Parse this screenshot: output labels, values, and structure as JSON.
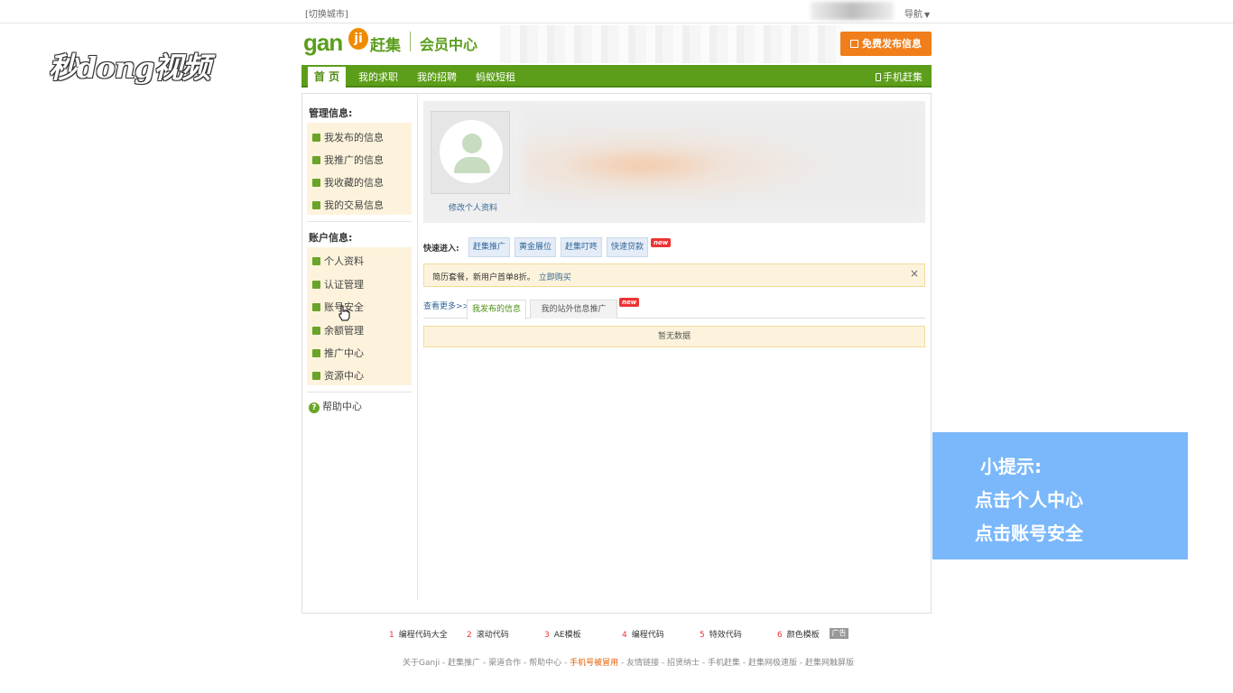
{
  "topbar": {
    "city_switch": "[切换城市]",
    "nav_menu": "导航"
  },
  "watermark": {
    "logo_text": "秒dong视频"
  },
  "header": {
    "logo_latin": "gan",
    "logo_badge": "ji",
    "logo_cn": "赶集",
    "member_center": "会员中心",
    "post_button": "免费发布信息"
  },
  "nav": {
    "tabs": [
      {
        "label": "首 页"
      },
      {
        "label": "我的求职"
      },
      {
        "label": "我的招聘"
      },
      {
        "label": "蚂蚁短租"
      }
    ],
    "mobile": "手机赶集"
  },
  "sidebar": {
    "manage_title": "管理信息:",
    "manage_items": [
      {
        "label": "我发布的信息"
      },
      {
        "label": "我推广的信息"
      },
      {
        "label": "我收藏的信息"
      },
      {
        "label": "我的交易信息"
      }
    ],
    "account_title": "账户信息:",
    "account_items": [
      {
        "label": "个人资料"
      },
      {
        "label": "认证管理"
      },
      {
        "label": "账号安全"
      },
      {
        "label": "余额管理"
      },
      {
        "label": "推广中心"
      },
      {
        "label": "资源中心"
      }
    ],
    "help": "帮助中心"
  },
  "profile": {
    "edit_link": "修改个人资料"
  },
  "quick_entry": {
    "label": "快速进入:",
    "buttons": [
      {
        "label": "赶集推广"
      },
      {
        "label": "黄金展位"
      },
      {
        "label": "赶集叮咚"
      },
      {
        "label": "快速贷款"
      }
    ],
    "new_badge": "new"
  },
  "notice": {
    "text": "简历套餐，新用户首单8折。",
    "link": "立即购买",
    "close": "×"
  },
  "posts": {
    "more": "查看更多>>",
    "tabs": [
      {
        "label": "我发布的信息"
      },
      {
        "label": "我的站外信息推广"
      }
    ],
    "new_badge": "new",
    "empty": "暂无数据"
  },
  "tip": {
    "title": "小提示:",
    "line1": "点击个人中心",
    "line2": "点击账号安全"
  },
  "footer": {
    "links": [
      {
        "num": "1",
        "label": "编程代码大全"
      },
      {
        "num": "2",
        "label": "滚动代码"
      },
      {
        "num": "3",
        "label": "AE模板"
      },
      {
        "num": "4",
        "label": "编程代码"
      },
      {
        "num": "5",
        "label": "特效代码"
      },
      {
        "num": "6",
        "label": "颜色模板"
      }
    ],
    "ad": "广告",
    "bottom_pre": "关于Ganji - 赶集推广 - 渠道合作 - 帮助中心 - ",
    "bottom_highlight": "手机号被冒用",
    "bottom_post": " - 友情链接 - 招贤纳士 - 手机赶集 - 赶集网极速版 - 赶集网触屏版"
  },
  "colors": {
    "brand_green": "#5c9e1a",
    "accent_orange": "#f07e1a",
    "tip_blue": "#7ab8fb"
  }
}
